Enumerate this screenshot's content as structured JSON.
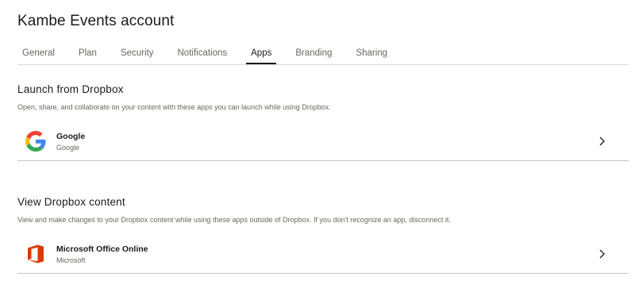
{
  "page": {
    "title": "Kambe Events account"
  },
  "tabs": [
    {
      "label": "General",
      "active": false
    },
    {
      "label": "Plan",
      "active": false
    },
    {
      "label": "Security",
      "active": false
    },
    {
      "label": "Notifications",
      "active": false
    },
    {
      "label": "Apps",
      "active": true
    },
    {
      "label": "Branding",
      "active": false
    },
    {
      "label": "Sharing",
      "active": false
    }
  ],
  "sections": [
    {
      "title": "Launch from Dropbox",
      "description": "Open, share, and collaborate on your content with these apps you can launch while using Dropbox.",
      "apps": [
        {
          "name": "Google",
          "publisher": "Google",
          "icon": "google-icon"
        }
      ]
    },
    {
      "title": "View Dropbox content",
      "description": "View and make changes to your Dropbox content while using these apps outside of Dropbox. If you don't recognize an app, disconnect it.",
      "apps": [
        {
          "name": "Microsoft Office Online",
          "publisher": "Microsoft",
          "icon": "microsoft-office-icon"
        }
      ]
    }
  ],
  "colors": {
    "text_primary": "#1e1919",
    "text_secondary": "#6b6661",
    "divider": "#dcd9d4",
    "office_orange": "#d83b01",
    "google_blue": "#4285f4",
    "google_red": "#ea4335",
    "google_yellow": "#fbbc05",
    "google_green": "#34a853"
  }
}
